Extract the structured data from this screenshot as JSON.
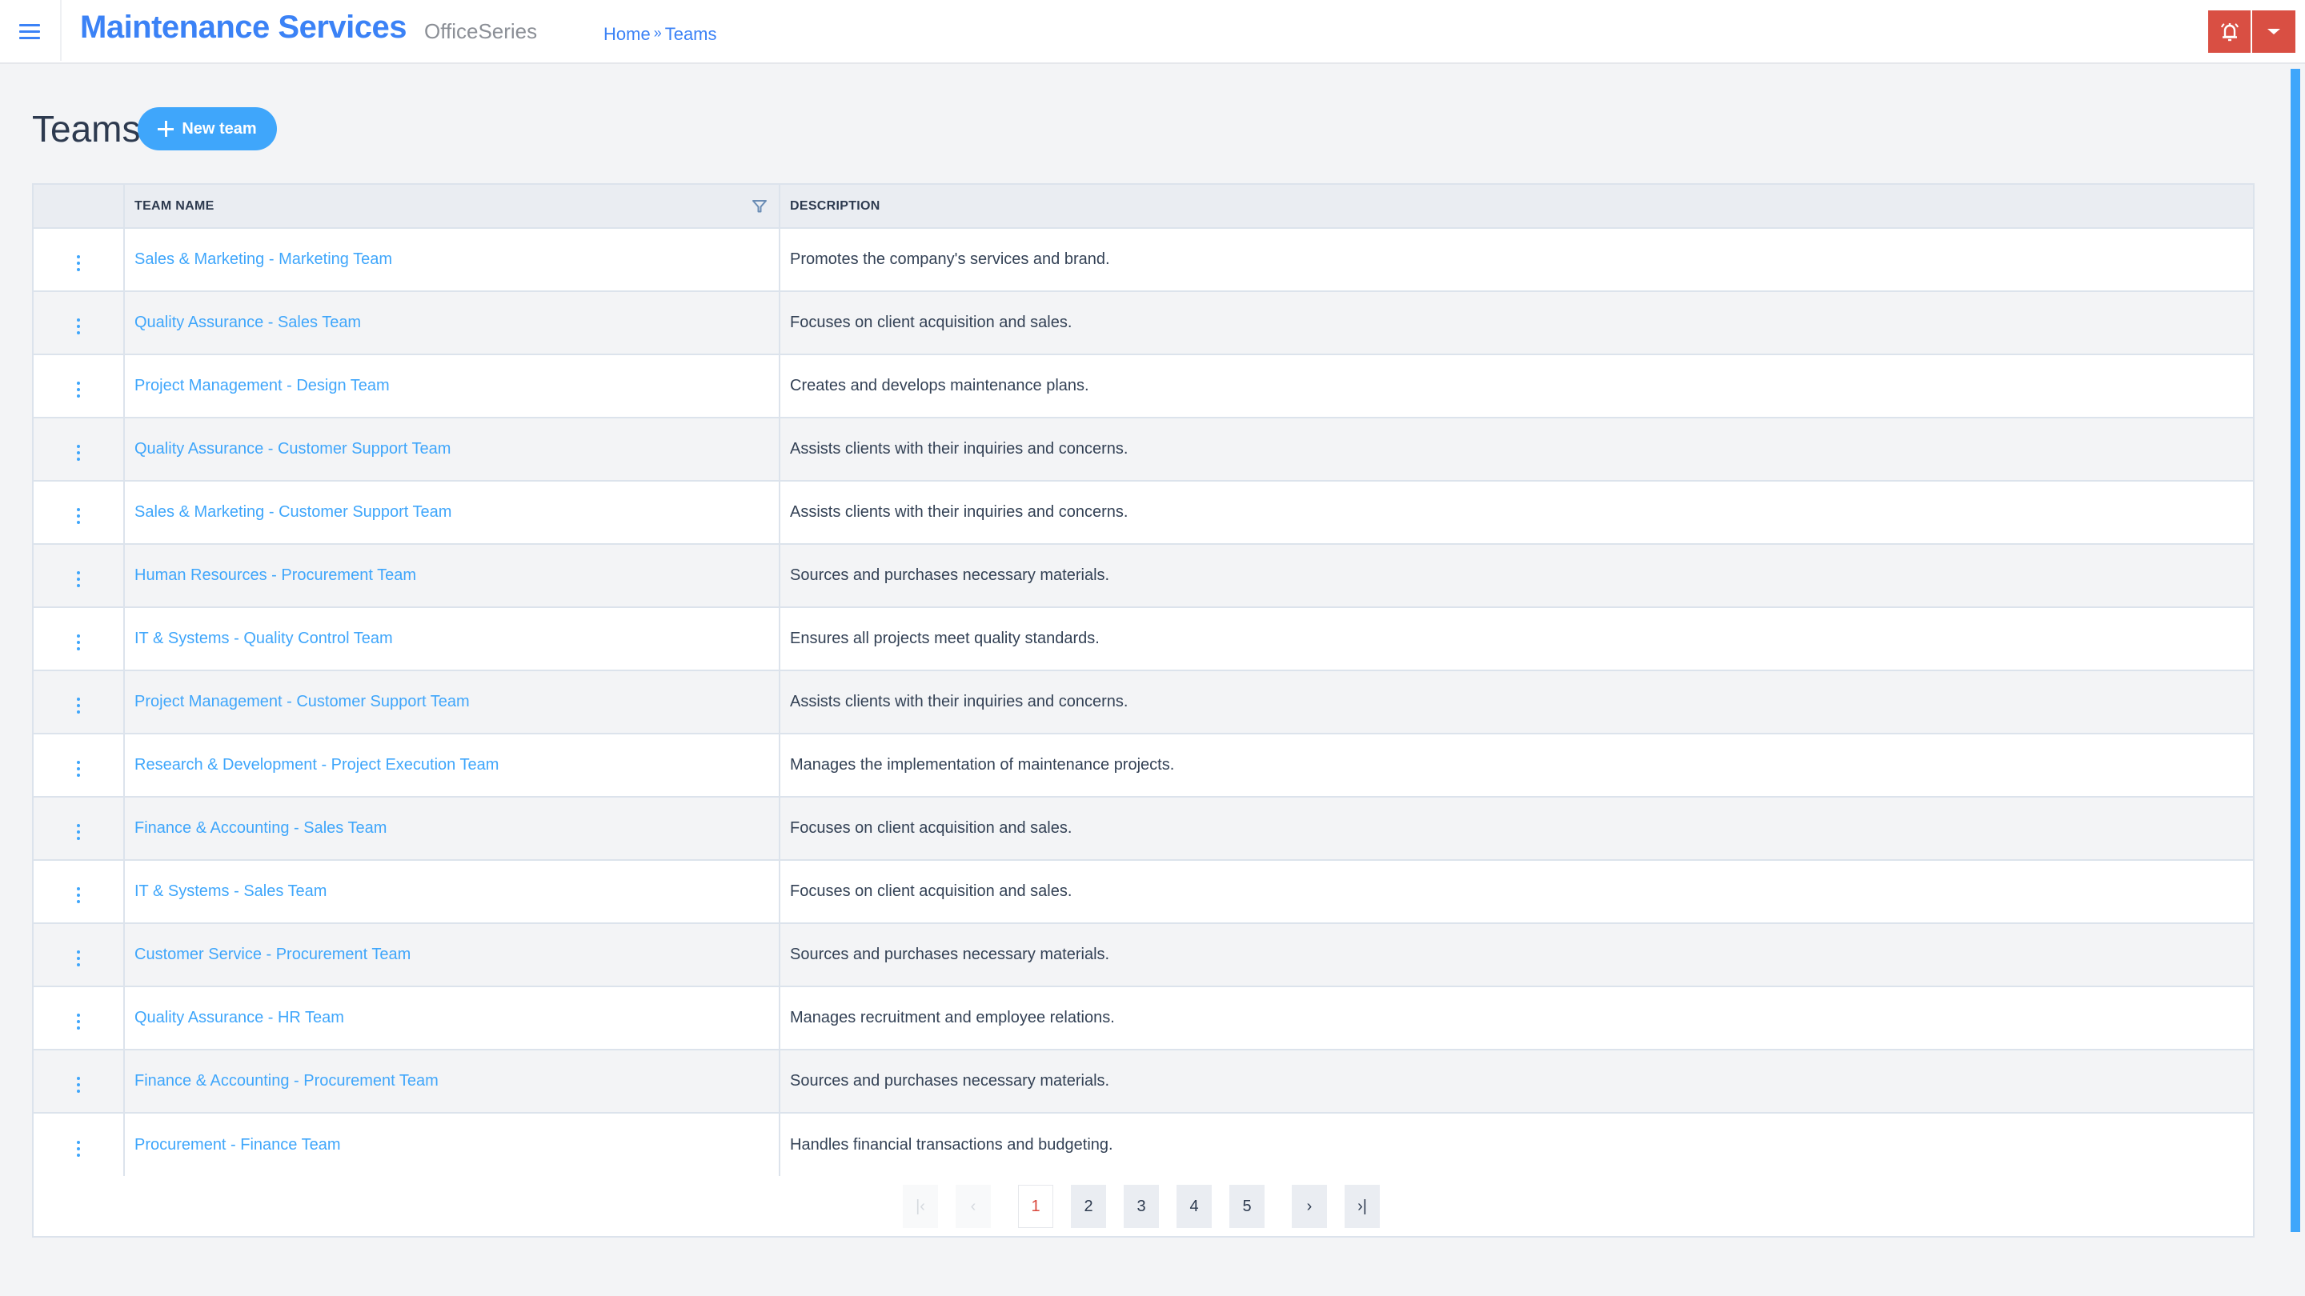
{
  "header": {
    "menu_icon": "hamburger-menu-icon",
    "app_title": "Maintenance Services",
    "app_subtitle": "OfficeSeries",
    "breadcrumb": [
      {
        "label": "Home"
      },
      {
        "separator": "»"
      },
      {
        "label": "Teams"
      }
    ],
    "alert_icon": "bell-ringing-icon",
    "dropdown_icon": "caret-down-icon",
    "accent_color": "#3b82f6",
    "alert_color": "#d94f43"
  },
  "page": {
    "title": "Teams",
    "new_button_label": "New team",
    "new_button_icon": "plus-icon",
    "button_color": "#3fa6fb"
  },
  "table": {
    "columns": [
      {
        "key": "actions",
        "label": ""
      },
      {
        "key": "team_name",
        "label": "TEAM NAME",
        "filter_icon": "filter-funnel-icon"
      },
      {
        "key": "description",
        "label": "DESCRIPTION"
      }
    ],
    "row_action_icon": "kebab-vertical-dots-icon",
    "rows": [
      {
        "team_name": "Sales & Marketing - Marketing Team",
        "description": "Promotes the company's services and brand."
      },
      {
        "team_name": "Quality Assurance - Sales Team",
        "description": "Focuses on client acquisition and sales."
      },
      {
        "team_name": "Project Management - Design Team",
        "description": "Creates and develops maintenance plans."
      },
      {
        "team_name": "Quality Assurance - Customer Support Team",
        "description": "Assists clients with their inquiries and concerns."
      },
      {
        "team_name": "Sales & Marketing - Customer Support Team",
        "description": "Assists clients with their inquiries and concerns."
      },
      {
        "team_name": "Human Resources - Procurement Team",
        "description": "Sources and purchases necessary materials."
      },
      {
        "team_name": "IT & Systems - Quality Control Team",
        "description": "Ensures all projects meet quality standards."
      },
      {
        "team_name": "Project Management - Customer Support Team",
        "description": "Assists clients with their inquiries and concerns."
      },
      {
        "team_name": "Research & Development - Project Execution Team",
        "description": "Manages the implementation of maintenance projects."
      },
      {
        "team_name": "Finance & Accounting - Sales Team",
        "description": "Focuses on client acquisition and sales."
      },
      {
        "team_name": "IT & Systems - Sales Team",
        "description": "Focuses on client acquisition and sales."
      },
      {
        "team_name": "Customer Service - Procurement Team",
        "description": "Sources and purchases necessary materials."
      },
      {
        "team_name": "Quality Assurance - HR Team",
        "description": "Manages recruitment and employee relations."
      },
      {
        "team_name": "Finance & Accounting - Procurement Team",
        "description": "Sources and purchases necessary materials."
      },
      {
        "team_name": "Procurement - Finance Team",
        "description": "Handles financial transactions and budgeting."
      }
    ]
  },
  "pagination": {
    "first_icon": "first-page-icon",
    "prev_icon": "previous-page-icon",
    "next_icon": "next-page-icon",
    "last_icon": "last-page-icon",
    "pages": [
      "1",
      "2",
      "3",
      "4",
      "5"
    ],
    "current_page": "1",
    "first_glyph": "|‹",
    "prev_glyph": "‹",
    "next_glyph": "›",
    "last_glyph": "›|"
  }
}
